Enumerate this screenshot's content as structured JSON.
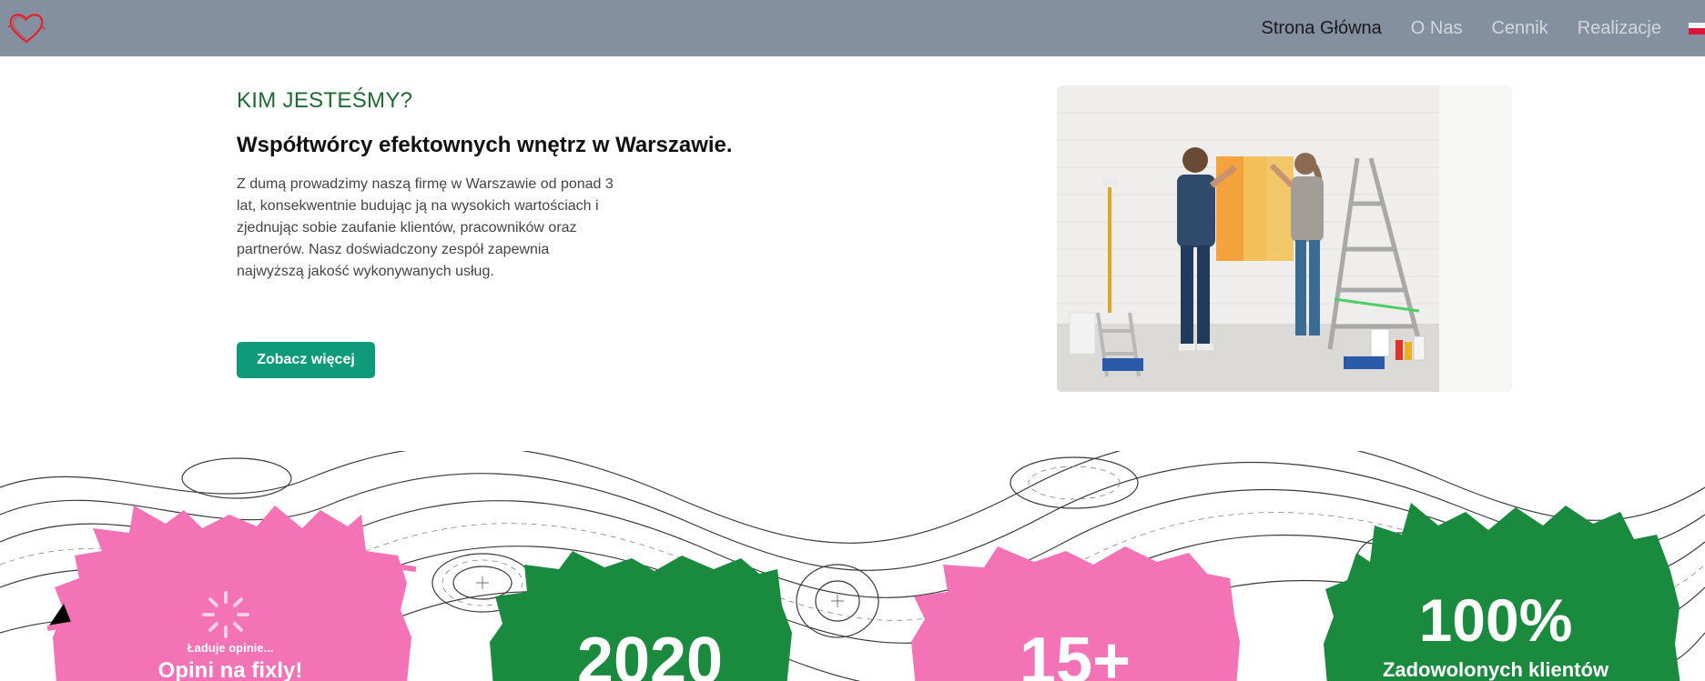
{
  "nav": {
    "items": [
      {
        "label": "Strona Główna",
        "active": true
      },
      {
        "label": "O Nas",
        "active": false
      },
      {
        "label": "Cennik",
        "active": false
      },
      {
        "label": "Realizacje",
        "active": false
      }
    ],
    "logo_icon": "heart-icon",
    "language_icon": "polish-flag-icon"
  },
  "intro": {
    "kicker": "KIM JESTEŚMY?",
    "headline": "Współtwórcy efektownych wnętrz w Warszawie.",
    "paragraph": "Z dumą prowadzimy naszą firmę w Warszawie od ponad 3 lat, konsekwentnie budując ją na wysokich wartościach i zjednując sobie zaufanie klientów, pracowników oraz partnerów. Nasz doświadczony zespół zapewnia najwyższą jakość wykonywanych usług.",
    "cta_label": "Zobacz więcej"
  },
  "stats": {
    "loading_text": "Ładuje opinie...",
    "reviews_title": "Opini na fixly!",
    "founded_year": "2020",
    "projects": "15+",
    "satisfaction_value": "100%",
    "satisfaction_label": "Zadowolonych klientów"
  },
  "colors": {
    "navbar": "#848fa0",
    "accent_green": "#1d6b30",
    "button": "#0f9b7a",
    "splash_pink": "#f472b6",
    "splash_green": "#1a8a3e"
  }
}
